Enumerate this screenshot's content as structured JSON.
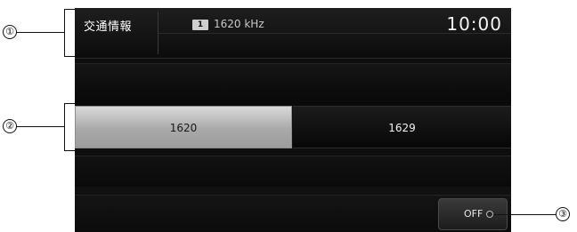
{
  "header": {
    "title": "交通情報",
    "preset_number": "1",
    "frequency": "1620 kHz",
    "clock": "10:00"
  },
  "frequencies": [
    {
      "label": "1620",
      "selected": true
    },
    {
      "label": "1629",
      "selected": false
    }
  ],
  "off_button": {
    "label": "OFF"
  },
  "callouts": [
    "①",
    "②",
    "③"
  ],
  "colors": {
    "screen_bg": "#0d0d0d",
    "selected_button": "#b0b0b0",
    "text": "#ffffff"
  }
}
